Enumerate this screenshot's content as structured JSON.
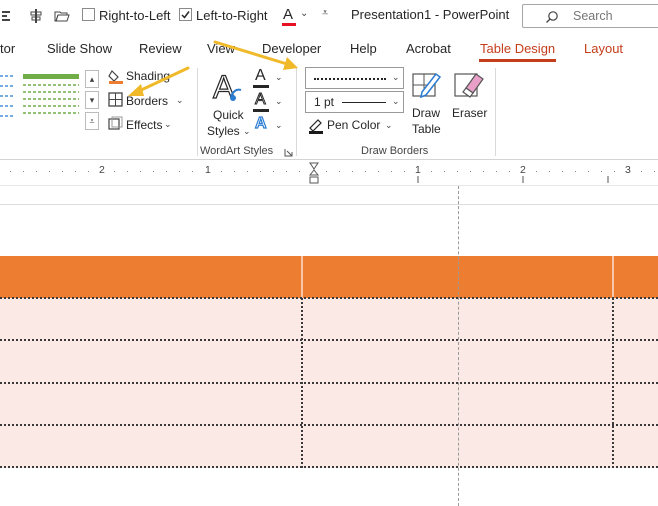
{
  "qat": {
    "right_to_left_label": "Right-to-Left",
    "left_to_right_label": "Left-to-Right",
    "left_to_right_checked": true,
    "font_color_letter": "A",
    "window_title": "Presentation1  -  PowerPoint",
    "search_placeholder": "Search"
  },
  "tabs": {
    "items": [
      "tor",
      "Slide Show",
      "Review",
      "View",
      "Developer",
      "Help",
      "Acrobat",
      "Table Design",
      "Layout"
    ],
    "active": "Table Design"
  },
  "ribbon": {
    "shading_label": "Shading",
    "borders_label": "Borders",
    "effects_label": "Effects",
    "quick_styles_label_1": "Quick",
    "quick_styles_label_2": "Styles",
    "wordart_group_label": "WordArt Styles",
    "pen_weight_value": "1 pt",
    "pen_color_label": "Pen Color",
    "draw_table_label_1": "Draw",
    "draw_table_label_2": "Table",
    "eraser_label": "Eraser",
    "draw_borders_group_label": "Draw Borders",
    "text_fill_letter": "A",
    "text_outline_letter": "A",
    "text_effects_letter": "A"
  },
  "ruler": {
    "labels": [
      "2",
      "1",
      "1",
      "2",
      "3"
    ]
  },
  "colors": {
    "accent": "#c43e1c",
    "table_header": "#ed7d31",
    "table_body": "#fbe9e5",
    "annotation_arrow": "#f0b929",
    "pen_color": "#1a1a1a",
    "font_color_bar": "#e81123"
  },
  "icons": {
    "align_icon": "align-center-icon",
    "open_icon": "folder-open-icon",
    "search_icon": "search-icon"
  }
}
